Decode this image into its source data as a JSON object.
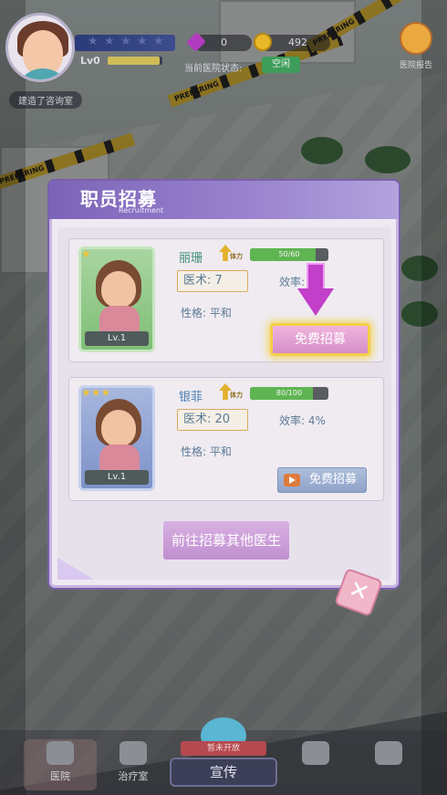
{
  "hud": {
    "level_label": "Lv0",
    "level_progress": 0.95,
    "gems": "0",
    "coins": "492",
    "status_label": "当前医院状态:",
    "status_value": "空闲",
    "report_label": "医院报告",
    "recent_event": "建造了咨询室",
    "tape_text": "PREPARING"
  },
  "modal": {
    "title": "职员招募",
    "subtitle": "Recruitment",
    "candidates": [
      {
        "name": "丽珊",
        "stars": "★",
        "level": "Lv.1",
        "stamina_label": "体力",
        "stamina": "50/60",
        "stamina_fraction": 0.8333,
        "skill": "医术: 7",
        "efficiency": "效率:",
        "personality": "性格: 平和",
        "action": "免费招募"
      },
      {
        "name": "银菲",
        "stars": "★★★",
        "level": "Lv.1",
        "stamina_label": "体力",
        "stamina": "80/100",
        "stamina_fraction": 0.8,
        "skill": "医术: 20",
        "efficiency": "效率: 4%",
        "personality": "性格: 平和",
        "action": "免费招募"
      }
    ],
    "goto_label": "前往招募其他医生",
    "close_label": "✕"
  },
  "nav": {
    "items": [
      {
        "label": "医院"
      },
      {
        "label": "治疗室"
      },
      {
        "label": ""
      },
      {
        "label": ""
      }
    ],
    "promo_tag": "暂未开放",
    "promo_label": "宣传"
  }
}
